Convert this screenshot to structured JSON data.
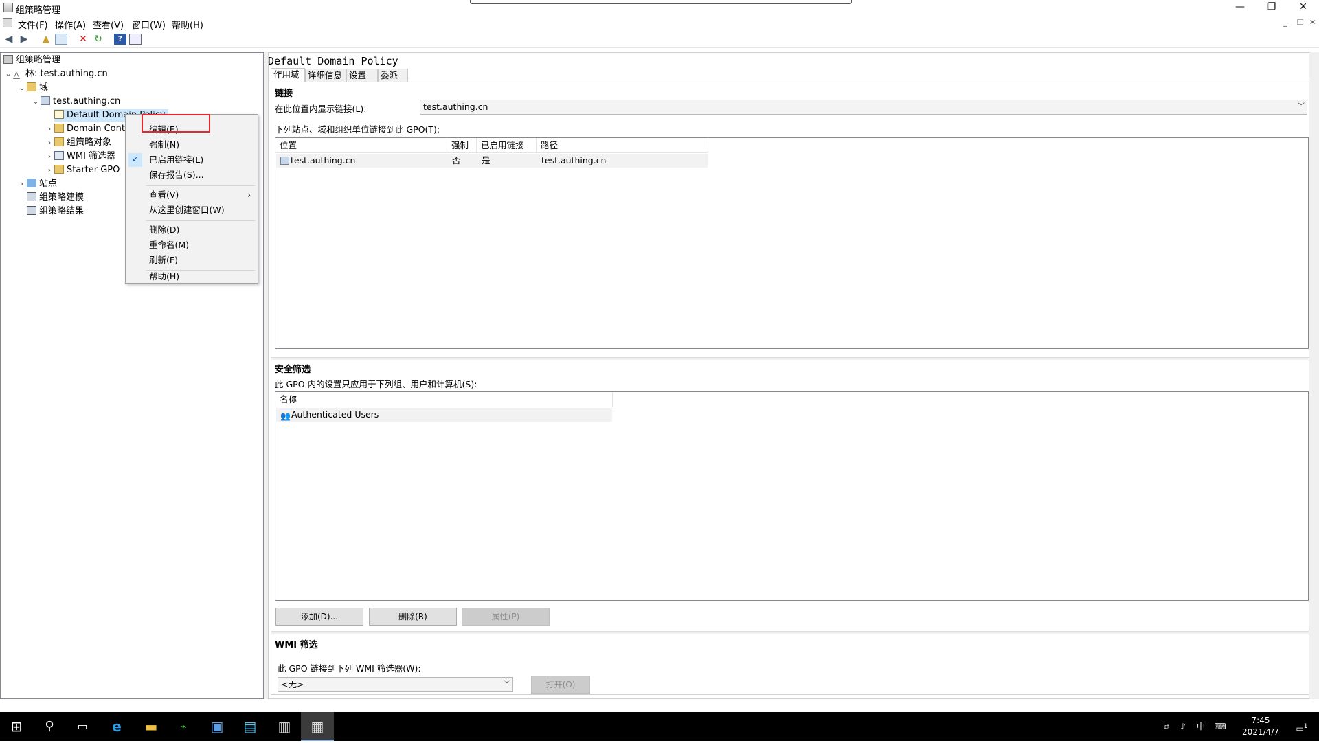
{
  "window": {
    "title": "组策略管理",
    "controls": {
      "minimize": "—",
      "restore": "❐",
      "close": "✕"
    }
  },
  "menubar": {
    "items": [
      "文件(F)",
      "操作(A)",
      "查看(V)",
      "窗口(W)",
      "帮助(H)"
    ],
    "mdi_controls": {
      "minimize": "_",
      "restore": "❐",
      "close": "✕"
    }
  },
  "toolbar": {
    "icons": [
      "back-icon",
      "forward-icon",
      "up-folder-icon",
      "show-hide-tree-icon",
      "delete-icon",
      "refresh-icon",
      "help-icon",
      "properties-icon"
    ]
  },
  "tree": {
    "root": "组策略管理",
    "forest": "林: test.authing.cn",
    "domains": "域",
    "domain": "test.authing.cn",
    "default_policy": "Default Domain Policy",
    "domain_controllers": "Domain Contr",
    "gpo_objects": "组策略对象",
    "wmi_filters": "WMI 筛选器",
    "starter_gpo": "Starter GPO",
    "sites": "站点",
    "modeling": "组策略建模",
    "results": "组策略结果"
  },
  "context_menu": {
    "items": [
      {
        "label": "编辑(E)...",
        "highlighted": true
      },
      {
        "label": "强制(N)"
      },
      {
        "label": "已启用链接(L)",
        "checked": true
      },
      {
        "label": "保存报告(S)..."
      },
      {
        "label": "查看(V)",
        "submenu": true
      },
      {
        "label": "从这里创建窗口(W)"
      },
      {
        "label": "删除(D)"
      },
      {
        "label": "重命名(M)"
      },
      {
        "label": "刷新(F)"
      },
      {
        "label": "帮助(H)"
      }
    ]
  },
  "details": {
    "policy_title": "Default Domain Policy",
    "tabs": [
      "作用域",
      "详细信息",
      "设置",
      "委派"
    ],
    "active_tab": "作用域",
    "links": {
      "heading": "链接",
      "location_label": "在此位置内显示链接(L):",
      "location_value": "test.authing.cn",
      "list_label": "下列站点、域和组织单位链接到此 GPO(T):",
      "columns": [
        "位置",
        "强制",
        "已启用链接",
        "路径"
      ],
      "rows": [
        {
          "location": "test.authing.cn",
          "enforced": "否",
          "enabled": "是",
          "path": "test.authing.cn"
        }
      ]
    },
    "security": {
      "heading": "安全筛选",
      "desc": "此 GPO 内的设置只应用于下列组、用户和计算机(S):",
      "columns": [
        "名称"
      ],
      "rows": [
        "Authenticated Users"
      ],
      "add_button": "添加(D)...",
      "remove_button": "删除(R)",
      "properties_button": "属性(P)"
    },
    "wmi": {
      "heading": "WMI 筛选",
      "desc": "此 GPO 链接到下列 WMI 筛选器(W):",
      "filter_value": "<无>",
      "open_button": "打开(O)"
    }
  },
  "taskbar": {
    "icons": [
      "start-icon",
      "search-icon",
      "task-view-icon",
      "internet-explorer-icon",
      "file-explorer-icon",
      "network-monitor-icon",
      "contacts-icon",
      "remote-desktop-icon",
      "server-manager-icon",
      "group-policy-icon"
    ],
    "ime": "中",
    "time": "7:45",
    "date": "2021/4/7",
    "notification_count": "1"
  }
}
